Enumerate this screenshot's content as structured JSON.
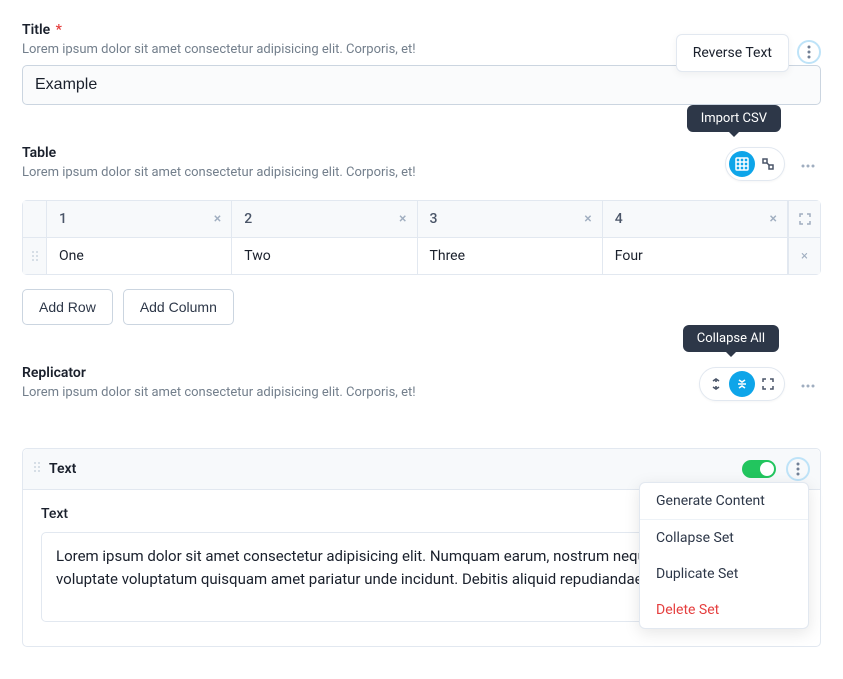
{
  "title_field": {
    "label": "Title",
    "required_marker": "*",
    "description": "Lorem ipsum dolor sit amet consectetur adipisicing elit. Corporis, et!",
    "value": "Example",
    "popover": "Reverse Text"
  },
  "table_field": {
    "label": "Table",
    "description": "Lorem ipsum dolor sit amet consectetur adipisicing elit. Corporis, et!",
    "tooltip": "Import CSV",
    "headers": [
      "1",
      "2",
      "3",
      "4"
    ],
    "row": [
      "One",
      "Two",
      "Three",
      "Four"
    ],
    "add_row": "Add Row",
    "add_column": "Add Column"
  },
  "replicator_field": {
    "label": "Replicator",
    "description": "Lorem ipsum dolor sit amet consectetur adipisicing elit. Corporis, et!",
    "tooltip": "Collapse All",
    "set_title": "Text",
    "sub_label": "Text",
    "textarea_value": "Lorem ipsum dolor sit amet consectetur adipisicing elit. Numquam earum, nostrum neque perspiciatis dolore voluptate voluptatum quisquam amet pariatur unde incidunt. Debitis aliquid repudiandae laboriosam.",
    "menu": {
      "generate": "Generate Content",
      "collapse": "Collapse Set",
      "duplicate": "Duplicate Set",
      "delete": "Delete Set"
    }
  }
}
